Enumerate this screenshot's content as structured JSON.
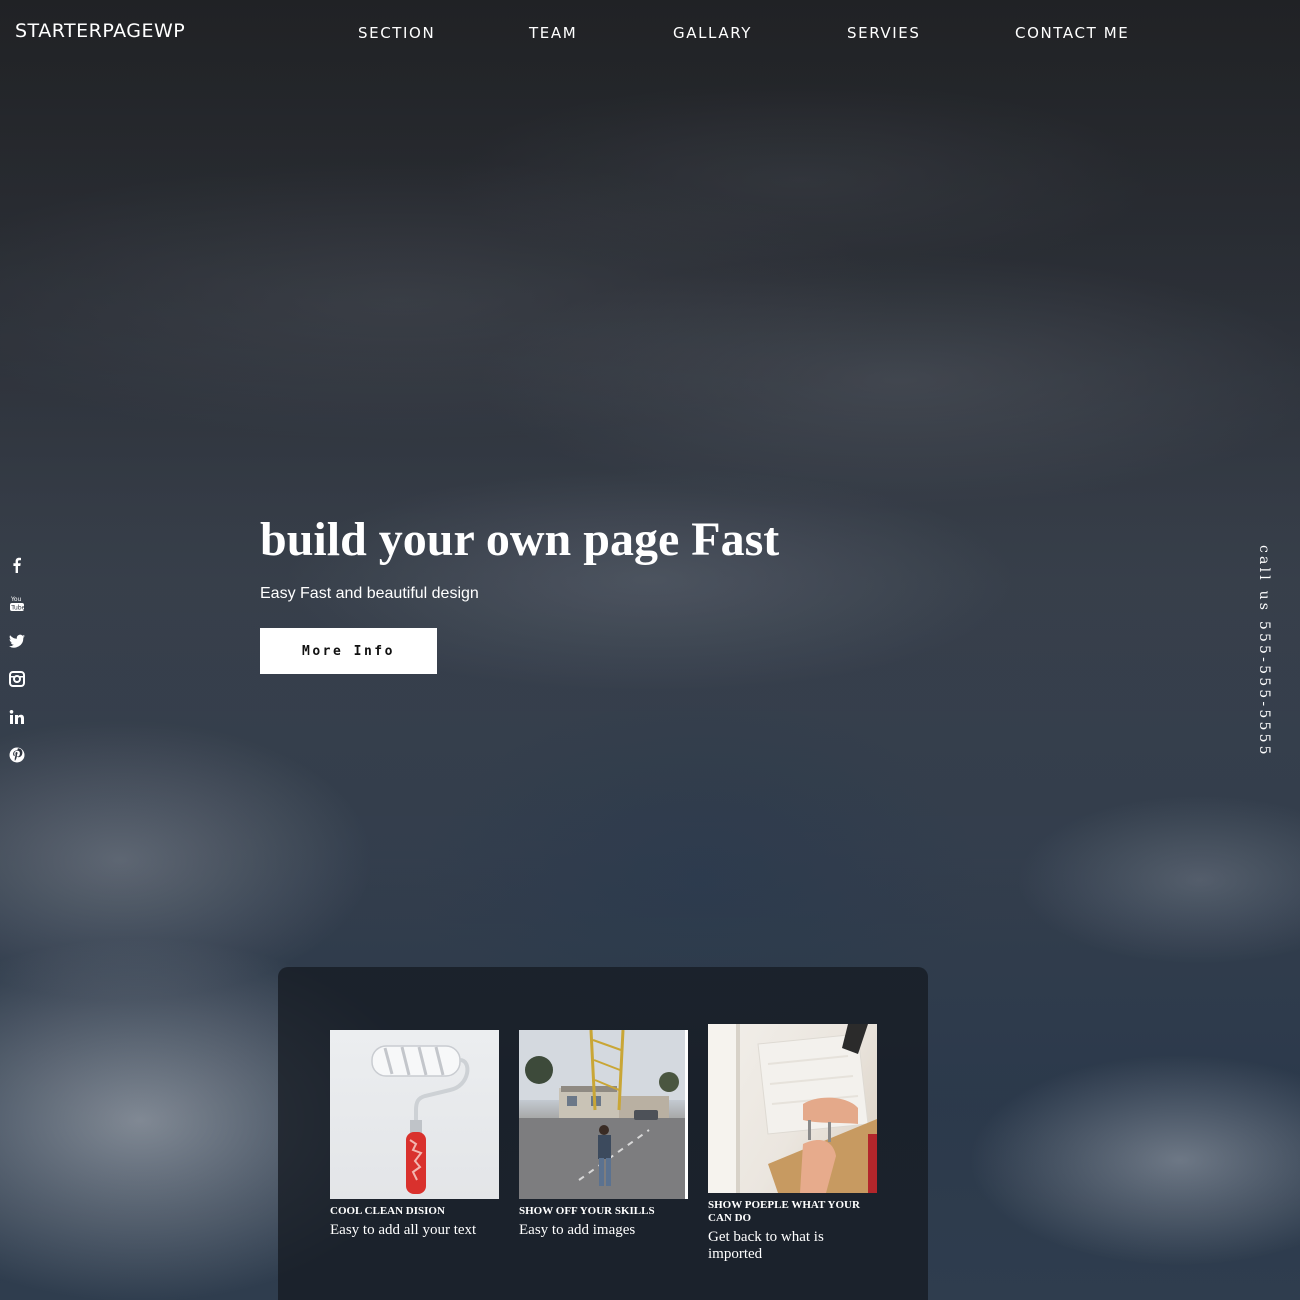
{
  "brand": "STARTERPAGEWP",
  "nav": [
    "SECTION",
    "TEAM",
    "GALLARY",
    "SERVIES",
    "CONTACT ME"
  ],
  "social": [
    "facebook-icon",
    "youtube-icon",
    "twitter-icon",
    "instagram-icon",
    "linkedin-icon",
    "pinterest-icon"
  ],
  "youtube_text": "You Tube",
  "call_us": "call us 555-555-5555",
  "hero": {
    "title": "build your own page Fast",
    "subtitle": "Easy Fast and beautiful design",
    "button": "More Info"
  },
  "features": [
    {
      "image": "paint-roller-image",
      "title": "COOL CLEAN DISION",
      "desc": "Easy to add all your text"
    },
    {
      "image": "street-scene-image",
      "title": "SHOW OFF YOUR SKILLS",
      "desc": "Easy to add images"
    },
    {
      "image": "tiling-hands-image",
      "title": "SHOW POEPLE WHAT YOUR CAN DO",
      "desc": "Get back to what is imported"
    }
  ],
  "colors": {
    "text": "#ffffff",
    "button_bg": "#ffffff",
    "button_text": "#111111",
    "panel_bg": "#161b22"
  }
}
